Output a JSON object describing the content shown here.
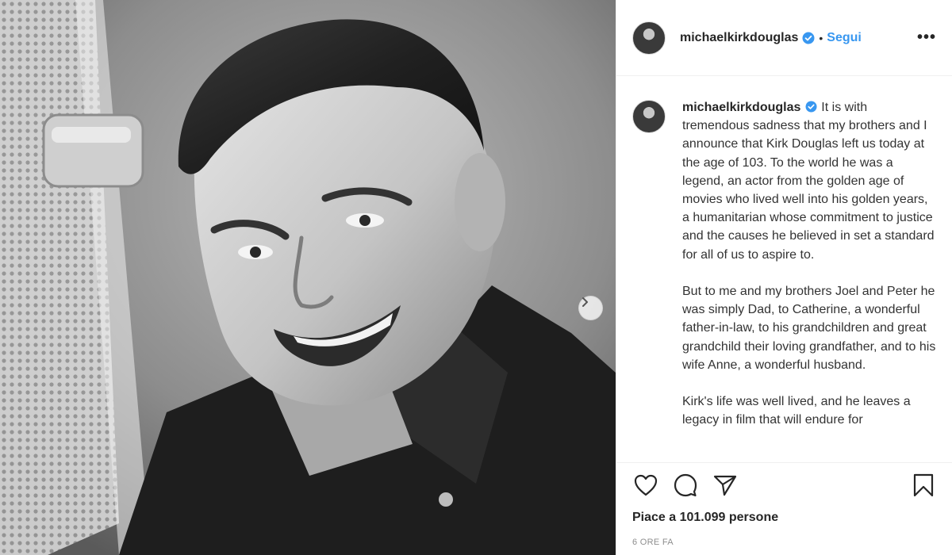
{
  "post": {
    "author": "michaelkirkdouglas",
    "separator": "•",
    "follow_label": "Segui",
    "more_label": "•••",
    "caption_paragraphs": [
      "It is with tremendous sadness that my brothers and I announce that Kirk Douglas left us today at the age of 103. To the world he was a legend, an actor from the golden age of movies who lived well into his golden years, a humanitarian whose commitment to justice and the causes he believed in set a standard for all of us to aspire to.",
      "But to me and my brothers Joel and Peter he was simply Dad, to Catherine, a wonderful father-in-law, to his grandchildren and great grandchild their loving grandfather, and to his wife Anne, a wonderful husband.",
      "Kirk's life was well lived, and he leaves a legacy in film that will endure for"
    ],
    "likes_text": "Piace a 101.099 persone",
    "timestamp": "6 ORE FA"
  },
  "icons": {
    "verified": "verified-badge-icon",
    "like": "heart-icon",
    "comment": "comment-icon",
    "share": "paper-plane-icon",
    "save": "bookmark-icon",
    "carousel_next": "chevron-right-icon"
  },
  "colors": {
    "accent": "#3897f0",
    "text": "#262626",
    "muted": "#8e8e8e",
    "border": "#efefef"
  }
}
